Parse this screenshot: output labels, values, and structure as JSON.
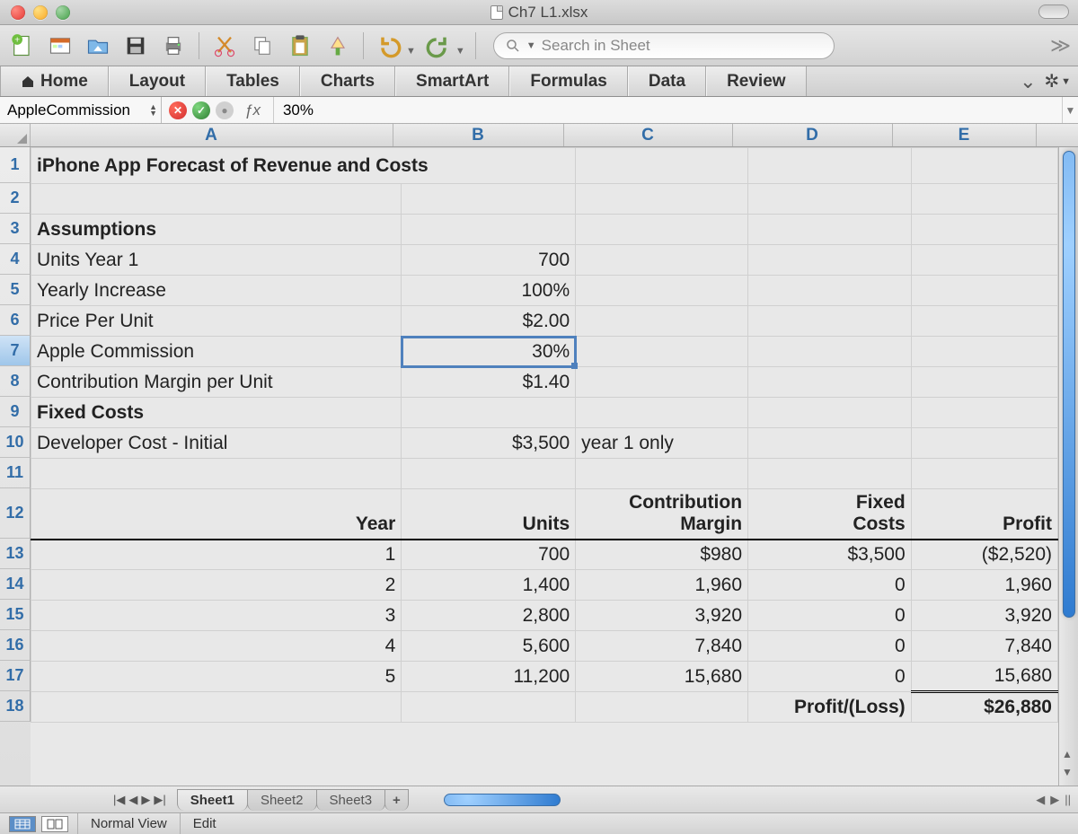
{
  "window": {
    "title": "Ch7 L1.xlsx"
  },
  "toolbar": {
    "search_placeholder": "Search in Sheet"
  },
  "ribbon": {
    "tabs": [
      "Home",
      "Layout",
      "Tables",
      "Charts",
      "SmartArt",
      "Formulas",
      "Data",
      "Review"
    ]
  },
  "name_box": "AppleCommission",
  "formula_bar_value": "30%",
  "columns": [
    "A",
    "B",
    "C",
    "D",
    "E"
  ],
  "row_numbers": [
    "1",
    "2",
    "3",
    "4",
    "5",
    "6",
    "7",
    "8",
    "9",
    "10",
    "11",
    "12",
    "13",
    "14",
    "15",
    "16",
    "17",
    "18"
  ],
  "selected_row": "7",
  "cells": {
    "title": "iPhone App Forecast of Revenue and Costs",
    "r3a": "Assumptions",
    "r4a": "Units Year 1",
    "r4b": "700",
    "r5a": "Yearly Increase",
    "r5b": "100%",
    "r6a": "Price Per Unit",
    "r6b": "$2.00",
    "r7a": "Apple Commission",
    "r7b": "30%",
    "r8a": "Contribution Margin per Unit",
    "r8b": "$1.40",
    "r9a": "Fixed  Costs",
    "r10a": "Developer Cost - Initial",
    "r10b": "$3,500",
    "r10c": "year 1 only",
    "r12a": "Year",
    "r12b": "Units",
    "r12c": "Contribution\nMargin",
    "r12d": "Fixed\nCosts",
    "r12e": "Profit",
    "r13a": "1",
    "r13b": "700",
    "r13c": "$980",
    "r13d": "$3,500",
    "r13e": "($2,520)",
    "r14a": "2",
    "r14b": "1,400",
    "r14c": "1,960",
    "r14d": "0",
    "r14e": "1,960",
    "r15a": "3",
    "r15b": "2,800",
    "r15c": "3,920",
    "r15d": "0",
    "r15e": "3,920",
    "r16a": "4",
    "r16b": "5,600",
    "r16c": "7,840",
    "r16d": "0",
    "r16e": "7,840",
    "r17a": "5",
    "r17b": "11,200",
    "r17c": "15,680",
    "r17d": "0",
    "r17e": "15,680",
    "r18d": "Profit/(Loss)",
    "r18e": "$26,880"
  },
  "sheet_tabs": [
    "Sheet1",
    "Sheet2",
    "Sheet3"
  ],
  "status": {
    "view_label": "Normal View",
    "mode": "Edit"
  },
  "chart_data": {
    "type": "table",
    "title": "iPhone App Forecast of Revenue and Costs",
    "assumptions": {
      "Units Year 1": 700,
      "Yearly Increase": "100%",
      "Price Per Unit": 2.0,
      "Apple Commission": "30%",
      "Contribution Margin per Unit": 1.4,
      "Developer Cost - Initial": 3500
    },
    "columns": [
      "Year",
      "Units",
      "Contribution Margin",
      "Fixed Costs",
      "Profit"
    ],
    "rows": [
      [
        1,
        700,
        980,
        3500,
        -2520
      ],
      [
        2,
        1400,
        1960,
        0,
        1960
      ],
      [
        3,
        2800,
        3920,
        0,
        3920
      ],
      [
        4,
        5600,
        7840,
        0,
        7840
      ],
      [
        5,
        11200,
        15680,
        0,
        15680
      ]
    ],
    "total_profit": 26880
  }
}
